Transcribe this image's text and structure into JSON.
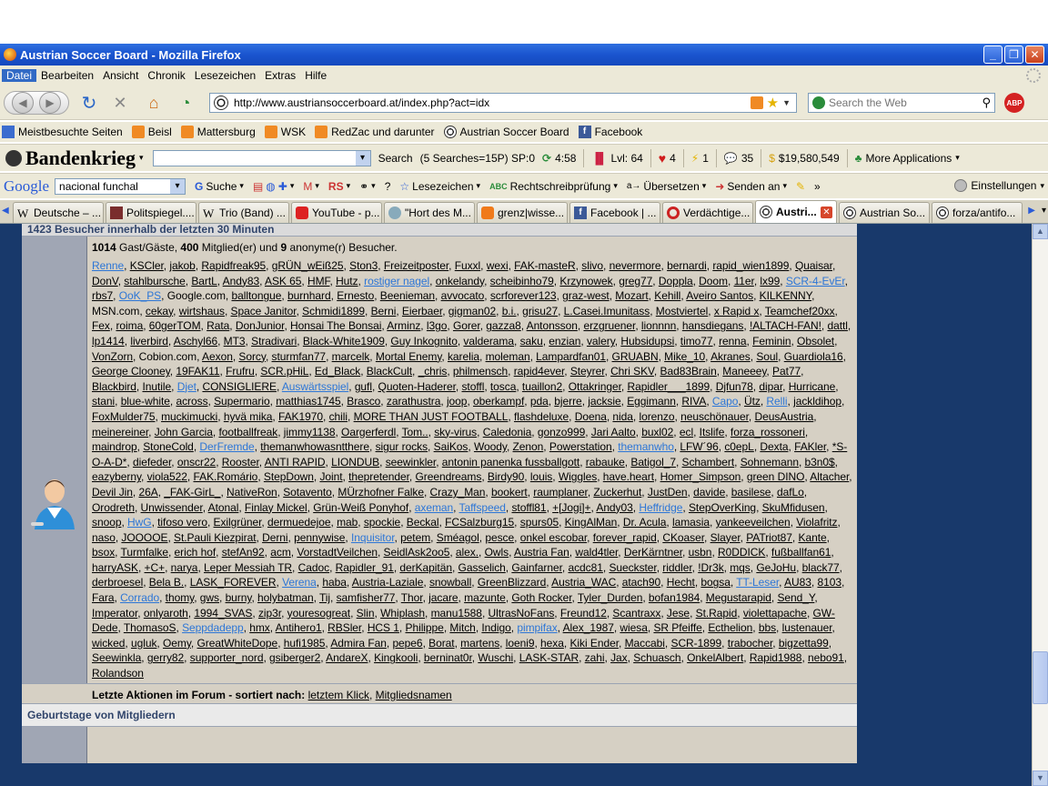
{
  "window": {
    "title": "Austrian Soccer Board - Mozilla Firefox"
  },
  "menu": [
    "Datei",
    "Bearbeiten",
    "Ansicht",
    "Chronik",
    "Lesezeichen",
    "Extras",
    "Hilfe"
  ],
  "nav": {
    "url": "http://www.austriansoccerboard.at/index.php?act=idx",
    "search_placeholder": "Search the Web"
  },
  "bookmarks": [
    {
      "label": "Meistbesuchte Seiten",
      "icon": "page-icon"
    },
    {
      "label": "Beisl",
      "icon": "rss-icon"
    },
    {
      "label": "Mattersburg",
      "icon": "rss-icon"
    },
    {
      "label": "WSK",
      "icon": "rss-icon"
    },
    {
      "label": "RedZac und darunter",
      "icon": "rss-icon"
    },
    {
      "label": "Austrian Soccer Board",
      "icon": "soccer-ball-icon"
    },
    {
      "label": "Facebook",
      "icon": "facebook-icon"
    }
  ],
  "gamebar": {
    "logo": "Bandenkrieg",
    "search_label": "Search",
    "searches": "(5 Searches=15P) SP:0",
    "timer": "4:58",
    "level": "Lvl: 64",
    "hearts": "4",
    "energy": "1",
    "stamina": "35",
    "money": "$19,580,549",
    "more_apps": "More Applications"
  },
  "googlebar": {
    "logo": "Google",
    "query": "nacional funchal",
    "suche": "Suche",
    "lesezeichen": "Lesezeichen",
    "rechtschreib": "Rechtschreibprüfung",
    "uebersetzen": "Übersetzen",
    "senden": "Senden an",
    "more": "»",
    "einstellungen": "Einstellungen"
  },
  "tabs": [
    {
      "label": "Deutsche – ...",
      "active": false
    },
    {
      "label": "Politspiegel....",
      "active": false
    },
    {
      "label": "Trio (Band) ...",
      "active": false
    },
    {
      "label": "YouTube - p...",
      "active": false
    },
    {
      "label": "\"Hort des M...",
      "active": false
    },
    {
      "label": "grenz|wisse...",
      "active": false
    },
    {
      "label": "Facebook | ...",
      "active": false
    },
    {
      "label": "Verdächtige...",
      "active": false
    },
    {
      "label": "Austri...",
      "active": true
    },
    {
      "label": "Austrian So...",
      "active": false
    },
    {
      "label": "forza/antifo...",
      "active": false
    }
  ],
  "board": {
    "stats_header": "1423 Besucher innerhalb der letzten 30 Minuten",
    "counts": {
      "guests_num": "1014",
      "guests_label": "Gast/Gäste,",
      "members_num": "400",
      "members_label": "Mitglied(er) und",
      "anon_num": "9",
      "anon_label": "anonyme(r) Besucher."
    },
    "last_actions_prefix": "Letzte Aktionen im Forum - sortiert nach:",
    "sort_last_click": "letztem Klick",
    "sort_member_names": "Mitgliedsnamen",
    "birthday_header": "Geburtstage von Mitgliedern",
    "members": [
      [
        "Renne",
        "m"
      ],
      [
        "KSCler"
      ],
      [
        "jakob"
      ],
      [
        "Rapidfreak95"
      ],
      [
        "gRÜN_wEiß25"
      ],
      [
        "Ston3"
      ],
      [
        "Freizeitposter"
      ],
      [
        "Fuxxl"
      ],
      [
        "wexi"
      ],
      [
        "FAK-masteR"
      ],
      [
        "slivo"
      ],
      [
        "nevermore"
      ],
      [
        "bernardi"
      ],
      [
        "rapid_wien1899"
      ],
      [
        "Quaisar"
      ],
      [
        "DonV"
      ],
      [
        "stahlbursche"
      ],
      [
        "BartL"
      ],
      [
        "Andy83"
      ],
      [
        "ASK 65"
      ],
      [
        "HMF"
      ],
      [
        "Hutz"
      ],
      [
        "rostiger nagel",
        "m"
      ],
      [
        "onkelandy"
      ],
      [
        "scheibinho79"
      ],
      [
        "Krzynowek"
      ],
      [
        "greg77"
      ],
      [
        "Doppla"
      ],
      [
        "Doom"
      ],
      [
        "11er"
      ],
      [
        "lx99"
      ],
      [
        "SCR-4-EvEr",
        "m"
      ],
      [
        "rbs7"
      ],
      [
        "OoK_PS",
        "m"
      ],
      [
        "Google.com",
        "g"
      ],
      [
        "balltongue"
      ],
      [
        "burnhard"
      ],
      [
        "Ernesto"
      ],
      [
        "Beenieman"
      ],
      [
        "avvocato"
      ],
      [
        "scrforever123"
      ],
      [
        "graz-west"
      ],
      [
        "Mozart"
      ],
      [
        "Kehill"
      ],
      [
        "Aveiro Santos"
      ],
      [
        "KILKENNY"
      ],
      [
        "MSN.com",
        "g"
      ],
      [
        "cekay"
      ],
      [
        "wirtshaus"
      ],
      [
        "Space Janitor"
      ],
      [
        "Schmidi1899"
      ],
      [
        "Berni"
      ],
      [
        "Eierbaer"
      ],
      [
        "gigman02"
      ],
      [
        "b.i."
      ],
      [
        "grisu27"
      ],
      [
        "L.Casei.Imunitass"
      ],
      [
        "Mostviertel"
      ],
      [
        "x Rapid x"
      ],
      [
        "Teamchef20xx"
      ],
      [
        "Fex"
      ],
      [
        "roima"
      ],
      [
        "60gerTOM"
      ],
      [
        "Rata"
      ],
      [
        "DonJunior"
      ],
      [
        "Honsai The Bonsai"
      ],
      [
        "Arminz"
      ],
      [
        "l3go"
      ],
      [
        "Gorer"
      ],
      [
        "gazza8"
      ],
      [
        "Antonsson"
      ],
      [
        "erzgruener"
      ],
      [
        "lionnnn"
      ],
      [
        "hansdiegans"
      ],
      [
        "!ALTACH-FAN!"
      ],
      [
        "dattl"
      ],
      [
        "lp1414"
      ],
      [
        "liverbird"
      ],
      [
        "Aschyl66"
      ],
      [
        "MT3"
      ],
      [
        "Stradivari"
      ],
      [
        "Black-White1909"
      ],
      [
        "Guy Inkognito"
      ],
      [
        "valderama"
      ],
      [
        "saku"
      ],
      [
        "enzian"
      ],
      [
        "valery"
      ],
      [
        "Hubsidupsi"
      ],
      [
        "timo77"
      ],
      [
        "renna"
      ],
      [
        "Feminin"
      ],
      [
        "Obsolet"
      ],
      [
        "VonZorn"
      ],
      [
        "Cobion.com",
        "g"
      ],
      [
        "Aexon"
      ],
      [
        "Sorcy"
      ],
      [
        "sturmfan77"
      ],
      [
        "marcelk"
      ],
      [
        "Mortal Enemy"
      ],
      [
        "karelia"
      ],
      [
        "moleman"
      ],
      [
        "Lampardfan01"
      ],
      [
        "GRUABN"
      ],
      [
        "Mike_10"
      ],
      [
        "Akranes"
      ],
      [
        "Soul"
      ],
      [
        "Guardiola16"
      ],
      [
        "George Clooney"
      ],
      [
        "19FAK11"
      ],
      [
        "Frufru"
      ],
      [
        "SCR.pHiL"
      ],
      [
        "Ed_Black"
      ],
      [
        "BlackCult"
      ],
      [
        "_chris"
      ],
      [
        "philmensch"
      ],
      [
        "rapid4ever"
      ],
      [
        "Steyrer"
      ],
      [
        "Chri SKV"
      ],
      [
        "Bad83Brain"
      ],
      [
        "Maneeey"
      ],
      [
        "Pat77"
      ],
      [
        "Blackbird"
      ],
      [
        "Inutile"
      ],
      [
        "Djet",
        "m"
      ],
      [
        "CONSIGLIERE"
      ],
      [
        "Auswärtsspiel",
        "m"
      ],
      [
        "gufl"
      ],
      [
        "Quoten-Haderer"
      ],
      [
        "stoffl"
      ],
      [
        "tosca"
      ],
      [
        "tuaillon2"
      ],
      [
        "Ottakringer"
      ],
      [
        "Rapidler___1899"
      ],
      [
        "Djfun78"
      ],
      [
        "dipar"
      ],
      [
        "Hurricane"
      ],
      [
        "stani"
      ],
      [
        "blue-white"
      ],
      [
        "across"
      ],
      [
        "Supermario"
      ],
      [
        "matthias1745"
      ],
      [
        "Brasco"
      ],
      [
        "zarathustra"
      ],
      [
        "joop"
      ],
      [
        "oberkampf"
      ],
      [
        "pda"
      ],
      [
        "bjerre"
      ],
      [
        "jacksie"
      ],
      [
        "Eggimann"
      ],
      [
        "RIVA"
      ],
      [
        "Capo",
        "m"
      ],
      [
        "Ütz"
      ],
      [
        "Relli",
        "m"
      ],
      [
        "jackldihop"
      ],
      [
        "FoxMulder75"
      ],
      [
        "muckimucki"
      ],
      [
        "hyvä mika"
      ],
      [
        "FAK1970"
      ],
      [
        "chili"
      ],
      [
        "MORE THAN JUST FOOTBALL"
      ],
      [
        "flashdeluxe"
      ],
      [
        "Doena"
      ],
      [
        "nida"
      ],
      [
        "lorenzo"
      ],
      [
        "neuschönauer"
      ],
      [
        "DeusAustria"
      ],
      [
        "meinereiner"
      ],
      [
        "John Garcia"
      ],
      [
        "footballfreak"
      ],
      [
        "jimmy1138"
      ],
      [
        "Oargerferdl"
      ],
      [
        "Tom.."
      ],
      [
        "sky-virus"
      ],
      [
        "Caledonia"
      ],
      [
        "gonzo999"
      ],
      [
        "Jari Aalto"
      ],
      [
        "buxl02"
      ],
      [
        "ecl"
      ],
      [
        "Itslife"
      ],
      [
        "forza_rossoneri"
      ],
      [
        "maindrop"
      ],
      [
        "StoneCold"
      ],
      [
        "DerFremde",
        "m"
      ],
      [
        "themanwhowasntthere"
      ],
      [
        "sigur rocks"
      ],
      [
        "SaiKos"
      ],
      [
        "Woody"
      ],
      [
        "Zenon"
      ],
      [
        "Powerstation"
      ],
      [
        "themanwho",
        "m"
      ],
      [
        "LFW´96"
      ],
      [
        "c0epL"
      ],
      [
        "Dexta"
      ],
      [
        "FAKler"
      ],
      [
        "*S-O-A-D*"
      ],
      [
        "diefeder"
      ],
      [
        "onscr22"
      ],
      [
        "Rooster"
      ],
      [
        "ANTI RAPID"
      ],
      [
        "LIONDUB"
      ],
      [
        "seewinkler"
      ],
      [
        "antonin panenka fussballgott"
      ],
      [
        "rabauke"
      ],
      [
        "Batigol_7"
      ],
      [
        "Schambert"
      ],
      [
        "Sohnemann"
      ],
      [
        "b3n0$"
      ],
      [
        "eazyberny"
      ],
      [
        "viola522"
      ],
      [
        "FAK.Romário"
      ],
      [
        "StepDown"
      ],
      [
        "Joint"
      ],
      [
        "thepretender"
      ],
      [
        "Greendreams"
      ],
      [
        "Birdy90"
      ],
      [
        "louis"
      ],
      [
        "Wiggles"
      ],
      [
        "have.heart"
      ],
      [
        "Homer_Simpson"
      ],
      [
        "green DINO"
      ],
      [
        "Altacher"
      ],
      [
        "Devil Jin"
      ],
      [
        "26A"
      ],
      [
        "_FAK-GirL_"
      ],
      [
        "NativeRon"
      ],
      [
        "Sotavento"
      ],
      [
        "MÜrzhofner Falke"
      ],
      [
        "Crazy_Man"
      ],
      [
        "bookert"
      ],
      [
        "raumplaner"
      ],
      [
        "Zuckerhut"
      ],
      [
        "JustDen"
      ],
      [
        "davide"
      ],
      [
        "basilese"
      ],
      [
        "dafLo"
      ],
      [
        "Orodreth"
      ],
      [
        "Unwissender"
      ],
      [
        "Atonal"
      ],
      [
        "Finlay Mickel"
      ],
      [
        "Grün-Weiß Ponyhof"
      ],
      [
        "axeman",
        "m"
      ],
      [
        "Taffspeed",
        "m"
      ],
      [
        "stoffl81"
      ],
      [
        "+[Jogi]+"
      ],
      [
        "Andy03"
      ],
      [
        "Heffridge",
        "m"
      ],
      [
        "StepOverKing"
      ],
      [
        "SkuMfidusen"
      ],
      [
        "snoop"
      ],
      [
        "HwG",
        "m"
      ],
      [
        "tifoso vero"
      ],
      [
        "Exilgrüner"
      ],
      [
        "dermuedejoe"
      ],
      [
        "mab"
      ],
      [
        "spockie"
      ],
      [
        "Beckal"
      ],
      [
        "FCSalzburg15"
      ],
      [
        "spurs05"
      ],
      [
        "KingAlMan"
      ],
      [
        "Dr. Acula"
      ],
      [
        "lamasia"
      ],
      [
        "yankeeveilchen"
      ],
      [
        "Violafritz"
      ],
      [
        "naso"
      ],
      [
        "JOOOOE"
      ],
      [
        "St.Pauli Kiezpirat"
      ],
      [
        "Derni"
      ],
      [
        "pennywise"
      ],
      [
        "Inquisitor",
        "m"
      ],
      [
        "petem"
      ],
      [
        "Sméagol"
      ],
      [
        "pesce"
      ],
      [
        "onkel escobar"
      ],
      [
        "forever_rapid"
      ],
      [
        "CKoaser"
      ],
      [
        "Slayer"
      ],
      [
        "PATriot87"
      ],
      [
        "Kante"
      ],
      [
        "bsox"
      ],
      [
        "Turmfalke"
      ],
      [
        "erich hof"
      ],
      [
        "stefAn92"
      ],
      [
        "acm"
      ],
      [
        "VorstadtVeilchen"
      ],
      [
        "SeidlAsk2oo5"
      ],
      [
        "alex."
      ],
      [
        "Owls"
      ],
      [
        "Austria Fan"
      ],
      [
        "wald4tler"
      ],
      [
        "DerKärntner"
      ],
      [
        "usbn"
      ],
      [
        "R0DDICK"
      ],
      [
        "fußballfan61"
      ],
      [
        "harryASK"
      ],
      [
        "+C+"
      ],
      [
        "narya"
      ],
      [
        "Leper Messiah TR"
      ],
      [
        "Cadoc"
      ],
      [
        "Rapidler_91"
      ],
      [
        "derKapitän"
      ],
      [
        "Gasselich"
      ],
      [
        "Gainfarner"
      ],
      [
        "acdc81"
      ],
      [
        "Sueckster"
      ],
      [
        "riddler"
      ],
      [
        "!Dr3k"
      ],
      [
        "mqs"
      ],
      [
        "GeJoHu"
      ],
      [
        "black77"
      ],
      [
        "derbroesel"
      ],
      [
        "Bela B."
      ],
      [
        "LASK_FOREVER"
      ],
      [
        "Verena",
        "m"
      ],
      [
        "haba"
      ],
      [
        "Austria-Laziale"
      ],
      [
        "snowball"
      ],
      [
        "GreenBlizzard"
      ],
      [
        "Austria_WAC"
      ],
      [
        "atach90"
      ],
      [
        "Hecht"
      ],
      [
        "bogsa"
      ],
      [
        "TT-Leser",
        "m"
      ],
      [
        "AU83"
      ],
      [
        "8103"
      ],
      [
        "Fara"
      ],
      [
        "Corrado",
        "m"
      ],
      [
        "thomy"
      ],
      [
        "gws"
      ],
      [
        "burny"
      ],
      [
        "holybatman"
      ],
      [
        "Tij"
      ],
      [
        "samfisher77"
      ],
      [
        "Thor"
      ],
      [
        "jacare"
      ],
      [
        "mazunte"
      ],
      [
        "Goth Rocker"
      ],
      [
        "Tyler_Durden"
      ],
      [
        "bofan1984"
      ],
      [
        "Megustarapid"
      ],
      [
        "Send_Y"
      ],
      [
        "Imperator"
      ],
      [
        "onlyaroth"
      ],
      [
        "1994_SVAS"
      ],
      [
        "zip3r"
      ],
      [
        "youresogreat"
      ],
      [
        "Slin"
      ],
      [
        "Whiplash"
      ],
      [
        "manu1588"
      ],
      [
        "UltrasNoFans"
      ],
      [
        "Freund12"
      ],
      [
        "Scantraxx"
      ],
      [
        "Jese"
      ],
      [
        "St.Rapid"
      ],
      [
        "violettapache"
      ],
      [
        "GW-Dede"
      ],
      [
        "ThomasoS"
      ],
      [
        "Seppdadepp",
        "m"
      ],
      [
        "hmx"
      ],
      [
        "Antihero1"
      ],
      [
        "RBSler"
      ],
      [
        "HCS 1"
      ],
      [
        "Philippe"
      ],
      [
        "Mitch"
      ],
      [
        "Indigo"
      ],
      [
        "pimpifax",
        "m"
      ],
      [
        "Alex_1987"
      ],
      [
        "wiesa"
      ],
      [
        "SR Pfeiffe"
      ],
      [
        "Ecthelion"
      ],
      [
        "bbs"
      ],
      [
        "lustenauer"
      ],
      [
        "wicked"
      ],
      [
        "ugluk"
      ],
      [
        "Oemy"
      ],
      [
        "GreatWhiteDope"
      ],
      [
        "hufi1985"
      ],
      [
        "Admira Fan"
      ],
      [
        "pepe6"
      ],
      [
        "Borat"
      ],
      [
        "martens"
      ],
      [
        "loeni9"
      ],
      [
        "hexa"
      ],
      [
        "Kiki Ender"
      ],
      [
        "Maccabi"
      ],
      [
        "SCR-1899"
      ],
      [
        "trabocher"
      ],
      [
        "bigzetta99"
      ],
      [
        "Seewinkla"
      ],
      [
        "gerry82"
      ],
      [
        "supporter_nord"
      ],
      [
        "gsiberger2"
      ],
      [
        "AndareX"
      ],
      [
        "Kingkooli"
      ],
      [
        "berninat0r"
      ],
      [
        "Wuschi"
      ],
      [
        "LASK-STAR"
      ],
      [
        "zahi"
      ],
      [
        "Jax"
      ],
      [
        "Schuasch"
      ],
      [
        "OnkelAlbert"
      ],
      [
        "Rapid1988"
      ],
      [
        "nebo91"
      ],
      [
        "Rolandson"
      ]
    ]
  }
}
